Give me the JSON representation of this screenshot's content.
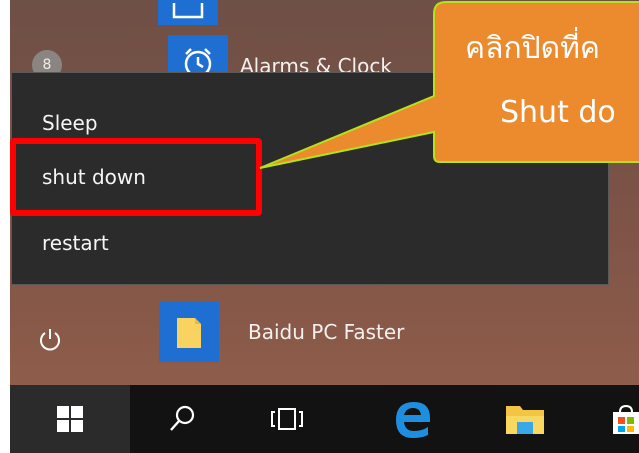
{
  "start_menu": {
    "apps": [
      {
        "label": "Alarms & Clock",
        "icon": "alarm-clock-icon"
      },
      {
        "label": "Baidu PC Faster",
        "icon": "baidu-folder-icon"
      }
    ],
    "user_icon_glyph": "8",
    "power_menu": {
      "items": [
        {
          "label": "Sleep"
        },
        {
          "label": "shut down"
        },
        {
          "label": "restart"
        }
      ]
    }
  },
  "callout": {
    "line1": "คลิกปิดที่ค",
    "line2": "Shut do"
  },
  "taskbar": {
    "buttons": [
      {
        "icon": "windows-start-icon"
      },
      {
        "icon": "search-icon"
      },
      {
        "icon": "task-view-icon"
      },
      {
        "icon": "edge-browser-icon"
      },
      {
        "icon": "file-explorer-icon"
      },
      {
        "icon": "store-icon"
      }
    ]
  },
  "colors": {
    "highlight": "#ff0000",
    "callout_fill": "#ec8a2e",
    "callout_border": "#b7e21a",
    "tile_blue": "#1e6fd1",
    "menu_bg": "#2b2b2b"
  }
}
